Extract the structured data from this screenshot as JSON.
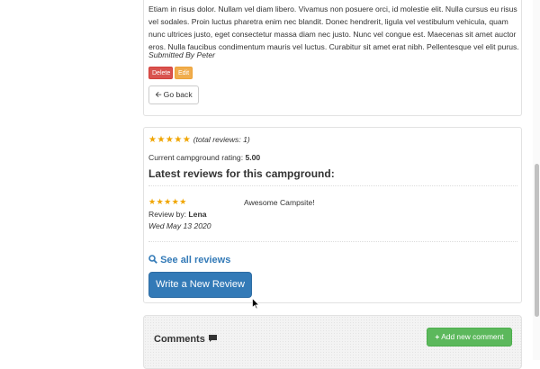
{
  "campground": {
    "description": "Etiam in risus dolor. Nullam vel diam libero. Vivamus non posuere orci, id molestie elit. Nulla cursus eu risus vel sodales. Proin luctus pharetra enim nec blandit. Donec hendrerit, ligula vel vestibulum vehicula, quam nunc ultrices justo, eget consectetur massa diam nec justo. Nunc vel congue est. Maecenas sit amet auctor eros. Nulla faucibus condimentum mauris vel luctus. Curabitur sit amet erat nibh. Pellentesque vel elit purus.",
    "submitted_by": "Submitted By Peter",
    "delete_label": "Delete",
    "edit_label": "Edit",
    "back_label": "Go back"
  },
  "reviews": {
    "stars": "★★★★★",
    "total_label": "(total reviews: 1)",
    "current_rating_label": "Current campground rating: ",
    "current_rating_value": "5.00",
    "heading": "Latest reviews for this campground:",
    "items": [
      {
        "stars": "★★★★★",
        "review_by_label": "Review by: ",
        "author": "Lena",
        "date": "Wed May 13 2020",
        "text": "Awesome Campsite!"
      }
    ],
    "see_all_label": "See all reviews",
    "write_label": "Write a New Review"
  },
  "comments": {
    "title": "Comments",
    "add_label": "Add new comment"
  },
  "colors": {
    "primary": "#337ab7",
    "danger": "#d9534f",
    "warning": "#f0ad4e",
    "success": "#5cb85c",
    "star": "#f0a500"
  },
  "icons": {
    "back": "arrow-left-icon",
    "search": "search-icon",
    "comment": "comment-icon",
    "plus": "plus-icon"
  }
}
